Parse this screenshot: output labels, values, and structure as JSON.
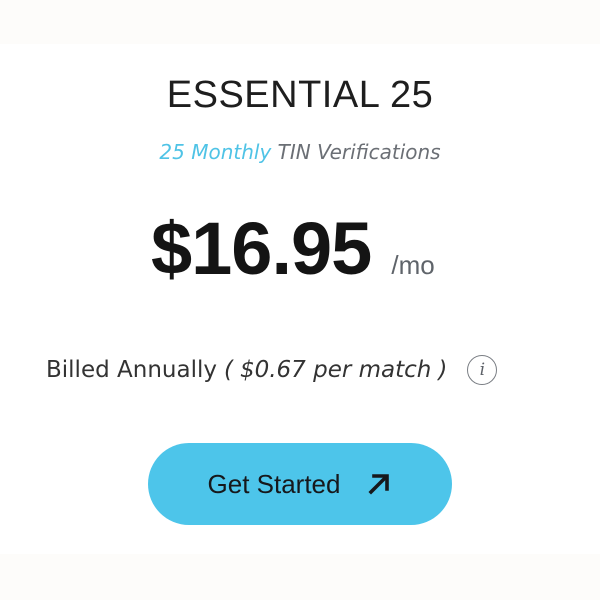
{
  "plan": {
    "title": "ESSENTIAL 25",
    "subtitle_accent": "25 Monthly",
    "subtitle_rest": "TIN Verifications"
  },
  "pricing": {
    "price": "$16.95",
    "period": "/mo",
    "billing_prefix": "Billed Annually",
    "open_paren": "(",
    "per_match": "$0.67 per match",
    "close_paren": ")",
    "info_icon": "info-icon",
    "info_glyph": "i"
  },
  "cta": {
    "label": "Get Started",
    "icon": "arrow-up-right-icon"
  },
  "colors": {
    "accent": "#4fc3e6",
    "button": "#4dc5ea",
    "text_dark": "#141414",
    "text_muted": "#6b6f75"
  }
}
